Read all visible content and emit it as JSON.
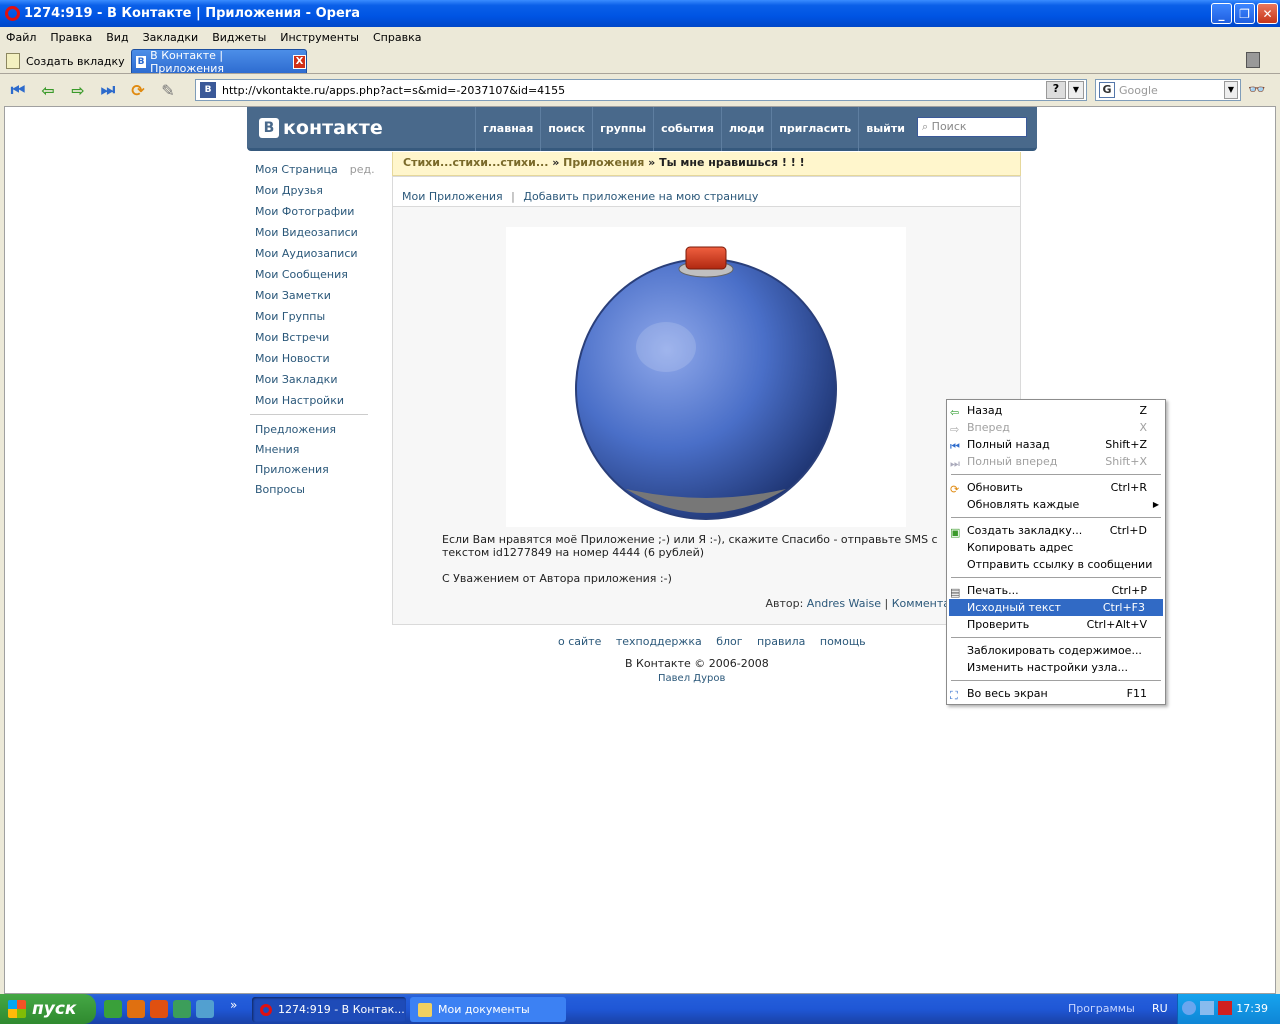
{
  "window": {
    "title": "1274:919 - В Контакте | Приложения - Opera",
    "min_label": "_",
    "max_label": "❐",
    "close_label": "✕"
  },
  "menu": [
    "Файл",
    "Правка",
    "Вид",
    "Закладки",
    "Виджеты",
    "Инструменты",
    "Справка"
  ],
  "tabs": {
    "new_tab_label": "Создать вкладку",
    "active_label": "В Контакте | Приложения",
    "close_label": "X"
  },
  "address": {
    "url": "http://vkontakte.ru/apps.php?act=s&mid=-2037107&id=4155",
    "help_label": "?",
    "search_placeholder": "Google"
  },
  "vk": {
    "logo": "контакте",
    "logo_mark": "В",
    "nav": [
      "главная",
      "поиск",
      "группы",
      "события",
      "люди",
      "пригласить",
      "выйти"
    ],
    "search_placeholder": "Поиск",
    "left_menu": [
      "Моя Страница",
      "Мои Друзья",
      "Мои Фотографии",
      "Мои Видеозаписи",
      "Мои Аудиозаписи",
      "Мои Сообщения",
      "Мои Заметки",
      "Мои Группы",
      "Мои Встречи",
      "Мои Новости",
      "Мои Закладки",
      "Мои Настройки"
    ],
    "edit_label": "ред.",
    "left_menu_extra": [
      "Предложения",
      "Мнения",
      "Приложения",
      "Вопросы"
    ],
    "breadcrumb": {
      "part1": "Стихи...стихи...стихи...",
      "sep1": " » ",
      "part2": "Приложения",
      "sep2": " » ",
      "current": "Ты мне нравишься ! ! !"
    },
    "content_tabs": {
      "my_apps": "Мои Приложения",
      "sep": "|",
      "add_app": "Добавить приложение на мою страницу"
    },
    "desc1": "Если Вам нравятся моё Приложение ;-) или Я :-), скажите Спасибо - отправьте SMS с текстом id1277849 на номер 4444 (6 рублей)",
    "desc2": "С Уважением от Автора приложения :-)",
    "author_label": "Автор:",
    "author_name": "Andres Waise",
    "author_sep": "|",
    "comments": "Коммента",
    "footer_links": [
      "о сайте",
      "техподдержка",
      "блог",
      "правила",
      "помощь"
    ],
    "copyright": "В Контакте © 2006-2008",
    "durov": "Павел Дуров"
  },
  "context_menu": {
    "items": [
      {
        "label": "Назад",
        "shortcut": "Z",
        "disabled": false
      },
      {
        "label": "Вперед",
        "shortcut": "X",
        "disabled": true
      },
      {
        "label": "Полный назад",
        "shortcut": "Shift+Z",
        "disabled": false
      },
      {
        "label": "Полный вперед",
        "shortcut": "Shift+X",
        "disabled": true
      },
      {
        "label": "Обновить",
        "shortcut": "Ctrl+R",
        "disabled": false
      },
      {
        "label": "Обновлять каждые",
        "shortcut": "",
        "disabled": false
      },
      {
        "label": "Создать закладку...",
        "shortcut": "Ctrl+D",
        "disabled": false
      },
      {
        "label": "Копировать адрес",
        "shortcut": "",
        "disabled": false
      },
      {
        "label": "Отправить ссылку в сообщении",
        "shortcut": "",
        "disabled": false
      },
      {
        "label": "Печать...",
        "shortcut": "Ctrl+P",
        "disabled": false
      },
      {
        "label": "Исходный текст",
        "shortcut": "Ctrl+F3",
        "disabled": false
      },
      {
        "label": "Проверить",
        "shortcut": "Ctrl+Alt+V",
        "disabled": false
      },
      {
        "label": "Заблокировать содержимое...",
        "shortcut": "",
        "disabled": false
      },
      {
        "label": "Изменить настройки узла...",
        "shortcut": "",
        "disabled": false
      },
      {
        "label": "Во весь экран",
        "shortcut": "F11",
        "disabled": false
      }
    ]
  },
  "taskbar": {
    "start": "пуск",
    "task1": "1274:919 - В Контак...",
    "task2": "Мои документы",
    "programs": "Программы",
    "lang": "RU",
    "clock": "17:39",
    "chevron": "»"
  },
  "colors": {
    "vk_header": "#49698b",
    "link": "#2b587a",
    "menu_highlight": "#316ac5",
    "ball": "#4a6fc8",
    "ball_cap": "#d9401e"
  }
}
